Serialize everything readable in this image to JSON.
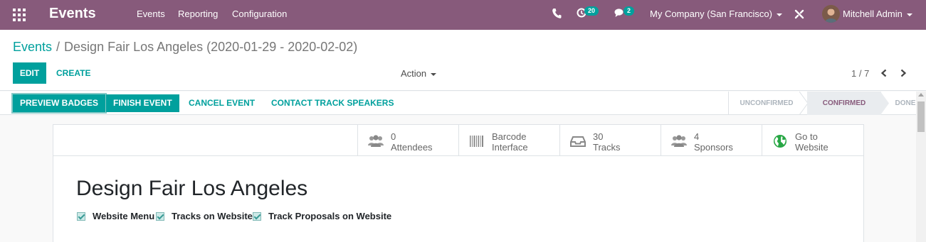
{
  "navbar": {
    "app_name": "Events",
    "menu": [
      "Events",
      "Reporting",
      "Configuration"
    ],
    "activity_count": "20",
    "message_count": "2",
    "company": "My Company (San Francisco)",
    "user": "Mitchell Admin",
    "color": "#875a7b"
  },
  "breadcrumb": {
    "parent": "Events",
    "separator": "/",
    "current": "Design Fair Los Angeles (2020-01-29 - 2020-02-02)"
  },
  "toolbar": {
    "edit_label": "EDIT",
    "create_label": "CREATE",
    "action_label": "Action"
  },
  "pager": {
    "value": "1 / 7"
  },
  "statusbar": {
    "buttons": [
      "PREVIEW BADGES",
      "FINISH EVENT",
      "CANCEL EVENT",
      "CONTACT TRACK SPEAKERS"
    ],
    "stages": [
      "UNCONFIRMED",
      "CONFIRMED",
      "DONE"
    ],
    "active_stage": "CONFIRMED"
  },
  "smart_buttons": [
    {
      "icon": "users-icon",
      "line1": "0",
      "line2": "Attendees"
    },
    {
      "icon": "barcode-icon",
      "line1": "Barcode",
      "line2": "Interface"
    },
    {
      "icon": "inbox-icon",
      "line1": "30",
      "line2": "Tracks"
    },
    {
      "icon": "users-icon",
      "line1": "4",
      "line2": "Sponsors"
    },
    {
      "icon": "globe-icon",
      "line1": "Go to",
      "line2": "Website"
    }
  ],
  "record": {
    "title": "Design Fair Los Angeles",
    "checkboxes": [
      {
        "label": "Website Menu",
        "checked": true
      },
      {
        "label": "Tracks on Website",
        "checked": true
      },
      {
        "label": "Track Proposals on Website",
        "checked": true
      }
    ]
  },
  "colors": {
    "primary": "#00a09d",
    "brand": "#875a7b"
  }
}
